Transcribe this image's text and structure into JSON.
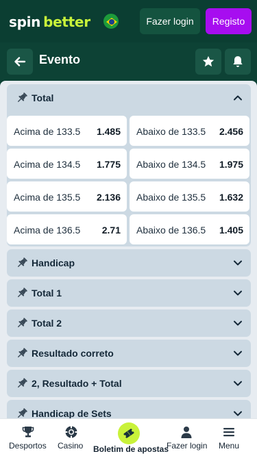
{
  "topbar": {
    "logo_part1": "spin",
    "logo_part2": "better",
    "login_label": "Fazer login",
    "register_label": "Registo"
  },
  "header": {
    "title": "Evento"
  },
  "colors": {
    "brand_dark": "#0b3e32",
    "accent_green": "#c9f23a",
    "register_purple": "#a70df0"
  },
  "markets": {
    "total": {
      "title": "Total",
      "rows": [
        {
          "left_label": "Acima de 133.5",
          "left_odd": "1.485",
          "right_label": "Abaixo de 133.5",
          "right_odd": "2.456"
        },
        {
          "left_label": "Acima de 134.5",
          "left_odd": "1.775",
          "right_label": "Abaixo de 134.5",
          "right_odd": "1.975"
        },
        {
          "left_label": "Acima de 135.5",
          "left_odd": "2.136",
          "right_label": "Abaixo de 135.5",
          "right_odd": "1.632"
        },
        {
          "left_label": "Acima de 136.5",
          "left_odd": "2.71",
          "right_label": "Abaixo de 136.5",
          "right_odd": "1.405"
        }
      ]
    },
    "collapsed": [
      {
        "title": "Handicap"
      },
      {
        "title": "Total 1"
      },
      {
        "title": "Total 2"
      },
      {
        "title": "Resultado correto"
      },
      {
        "title": "2, Resultado + Total"
      },
      {
        "title": "Handicap de Sets"
      }
    ]
  },
  "bottom_nav": {
    "items": [
      {
        "label": "Desportos",
        "icon": "trophy-icon"
      },
      {
        "label": "Casino",
        "icon": "chip-icon"
      },
      {
        "label": "Boletim de apostas",
        "icon": "ticket-icon"
      },
      {
        "label": "Fazer login",
        "icon": "user-icon"
      },
      {
        "label": "Menu",
        "icon": "menu-icon"
      }
    ]
  }
}
